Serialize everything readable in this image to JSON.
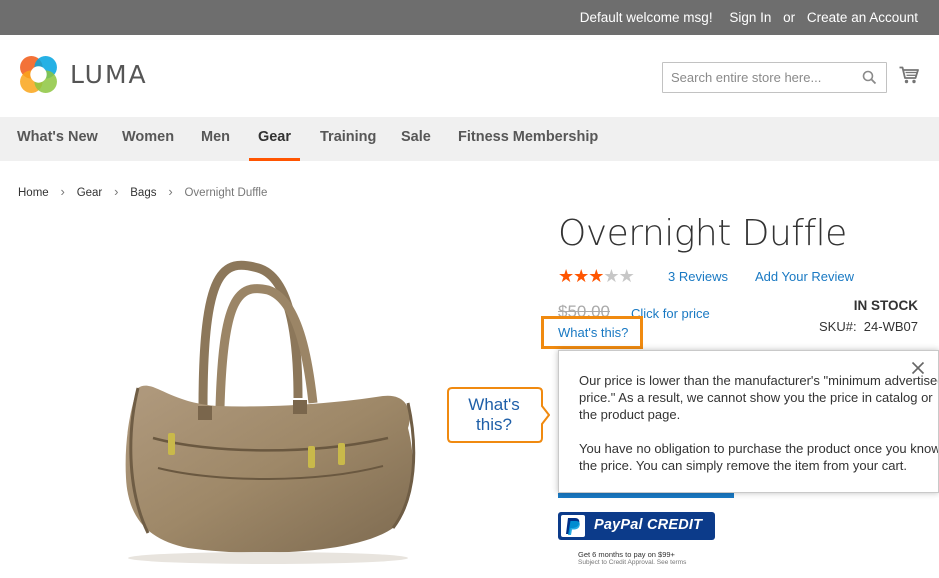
{
  "top_panel": {
    "welcome": "Default welcome msg!",
    "sign_in": "Sign In",
    "or": "or",
    "create_account": "Create an Account"
  },
  "logo": {
    "text": "LUMA",
    "icon": "luma-logo-icon"
  },
  "search": {
    "placeholder": "Search entire store here...",
    "value": "",
    "icon": "search-icon"
  },
  "cart": {
    "icon": "cart-icon"
  },
  "nav": {
    "items": [
      {
        "label": "What's New"
      },
      {
        "label": "Women"
      },
      {
        "label": "Men"
      },
      {
        "label": "Gear",
        "active": true
      },
      {
        "label": "Training"
      },
      {
        "label": "Sale"
      },
      {
        "label": "Fitness Membership"
      }
    ]
  },
  "breadcrumb": {
    "items": [
      "Home",
      "Gear",
      "Bags"
    ],
    "current": "Overnight Duffle",
    "separator": "›"
  },
  "product": {
    "title": "Overnight Duffle",
    "rating": {
      "filled": 3,
      "total": 5
    },
    "reviews_link": "3 Reviews",
    "add_review_link": "Add Your Review",
    "old_price": "$50.00",
    "click_for_price": "Click for price",
    "whats_this": "What's this?",
    "stock": "IN STOCK",
    "sku_label": "SKU#:",
    "sku_value": "24-WB07"
  },
  "callout": {
    "text": "What's this?"
  },
  "popup": {
    "paragraph1": "Our price is lower than the manufacturer's \"minimum advertised price.\" As a result, we cannot show you the price in catalog or the product page.",
    "paragraph2": "You have no obligation to purchase the product once you know the price. You can simply remove the item from your cart.",
    "close_icon": "close-icon"
  },
  "paypal": {
    "label": "PayPal CREDIT",
    "line1": "Get 6 months to pay on $99+",
    "line2": "Subject to Credit Approval. See terms"
  },
  "colors": {
    "accent": "#ff5501",
    "link": "#1979c3",
    "highlight_border": "#f08a10",
    "top_bar": "#6e6e6e",
    "nav_bg": "#f0f0f0",
    "paypal_blue": "#0c3b8a"
  }
}
